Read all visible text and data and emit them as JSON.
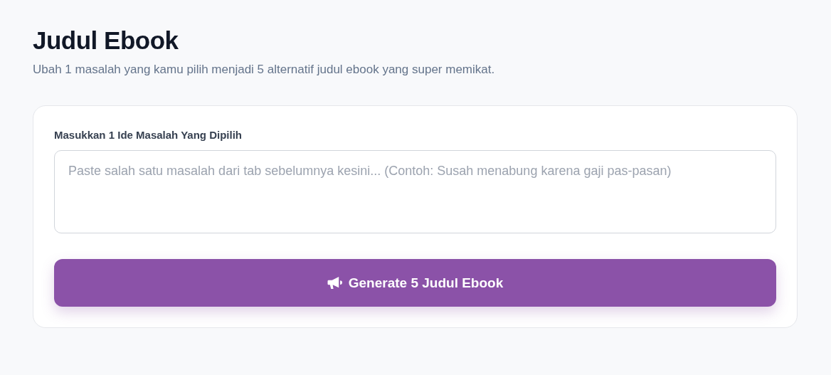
{
  "header": {
    "title": "Judul Ebook",
    "subtitle": "Ubah 1 masalah yang kamu pilih menjadi 5 alternatif judul ebook yang super memikat."
  },
  "form": {
    "label": "Masukkan 1 Ide Masalah Yang Dipilih",
    "placeholder": "Paste salah satu masalah dari tab sebelumnya kesini... (Contoh: Susah menabung karena gaji pas-pasan)",
    "button": "Generate 5 Judul Ebook"
  }
}
